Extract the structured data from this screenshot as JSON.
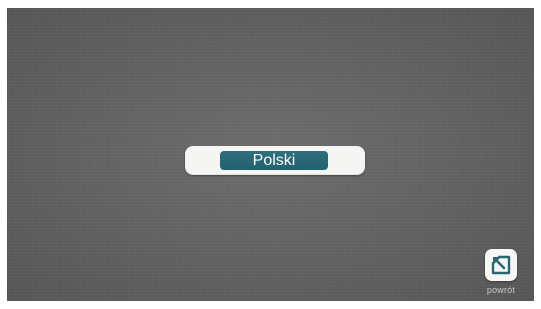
{
  "language_selector": {
    "selected_language": "Polski"
  },
  "footer": {
    "back_label": "powrót",
    "back_icon": "back-arrow-icon"
  },
  "colors": {
    "background": "#6b6b6b",
    "button_accent": "#2a6776",
    "pill_background": "#f5f5f3",
    "back_label_text": "#c8c8c8"
  }
}
